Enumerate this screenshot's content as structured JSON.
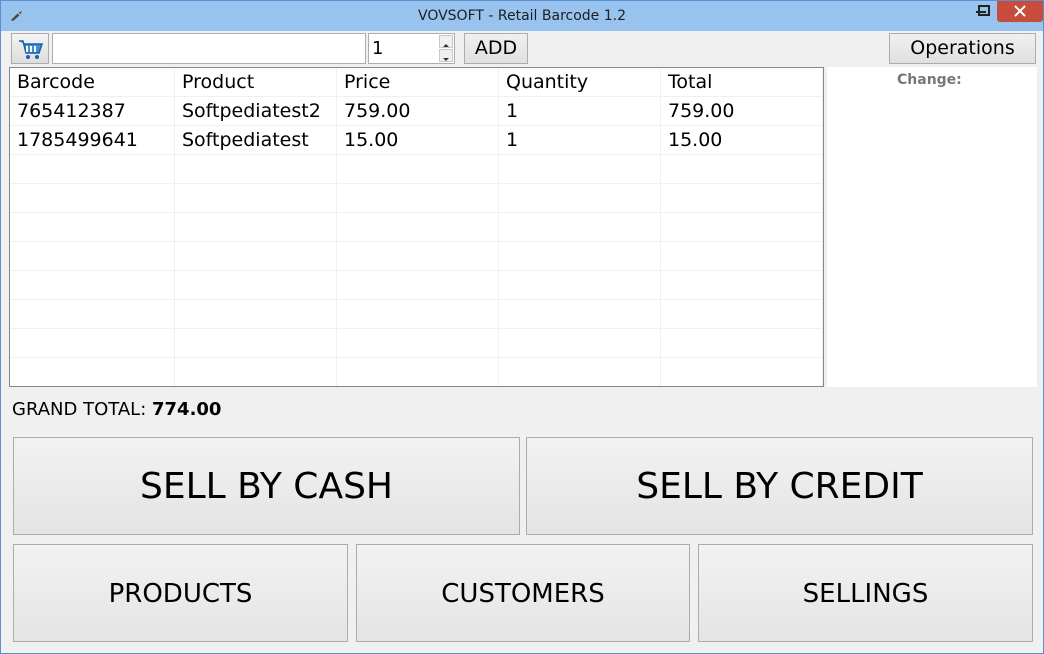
{
  "window": {
    "title": "VOVSOFT - Retail Barcode 1.2",
    "minimize_glyph": "–",
    "maximize_glyph": "□",
    "close_glyph": "✕"
  },
  "toolbar": {
    "cart_icon": "shopping-cart-icon",
    "barcode_value": "",
    "quantity_value": "1",
    "add_label": "ADD",
    "operations_label": "Operations"
  },
  "table": {
    "columns": [
      "Barcode",
      "Product",
      "Price",
      "Quantity",
      "Total"
    ],
    "rows": [
      [
        "765412387",
        "Softpediatest2",
        "759.00",
        "1",
        "759.00"
      ],
      [
        "1785499641",
        "Softpediatest",
        "15.00",
        "1",
        "15.00"
      ]
    ],
    "empty_rows": 8
  },
  "side_panel": {
    "change_label": "Change:"
  },
  "totals": {
    "grand_total_label": "GRAND TOTAL:",
    "grand_total_value": "774.00"
  },
  "actions": {
    "sell_cash": "SELL BY CASH",
    "sell_credit": "SELL BY CREDIT",
    "products": "PRODUCTS",
    "customers": "CUSTOMERS",
    "sellings": "SELLINGS"
  },
  "colors": {
    "titlebar": "#98c3ef",
    "close_button": "#c74c3c",
    "window_bg": "#f0f0f0"
  }
}
